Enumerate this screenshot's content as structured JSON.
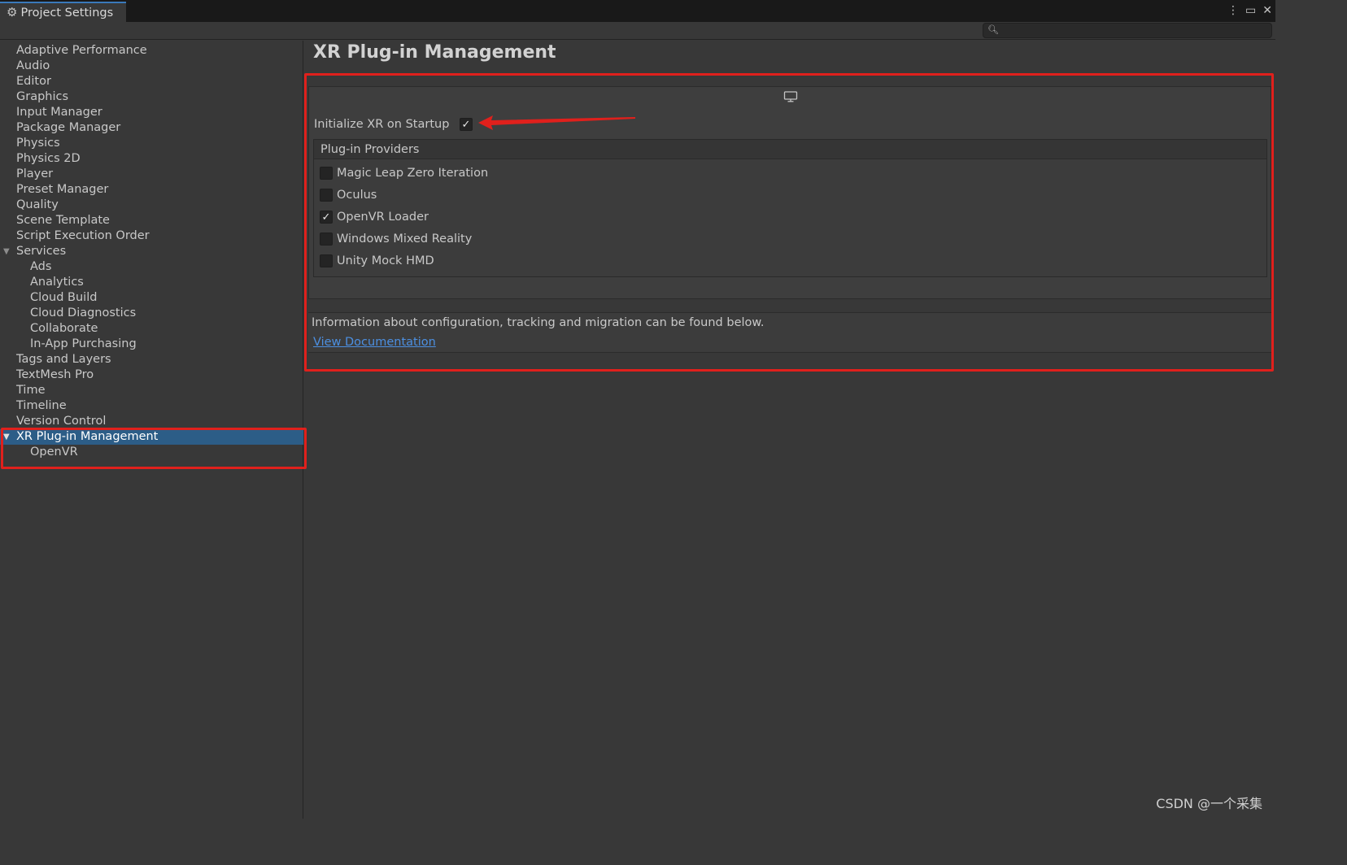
{
  "window": {
    "tab_title": "Project Settings",
    "tab_icon": "gear-icon",
    "controls": {
      "menu": "⋮",
      "maximize": "▭",
      "close": "✕"
    }
  },
  "search": {
    "value": "",
    "placeholder": ""
  },
  "sidebar": {
    "items": [
      {
        "label": "Adaptive Performance",
        "level": 0
      },
      {
        "label": "Audio",
        "level": 0
      },
      {
        "label": "Editor",
        "level": 0
      },
      {
        "label": "Graphics",
        "level": 0
      },
      {
        "label": "Input Manager",
        "level": 0
      },
      {
        "label": "Package Manager",
        "level": 0
      },
      {
        "label": "Physics",
        "level": 0
      },
      {
        "label": "Physics 2D",
        "level": 0
      },
      {
        "label": "Player",
        "level": 0
      },
      {
        "label": "Preset Manager",
        "level": 0
      },
      {
        "label": "Quality",
        "level": 0
      },
      {
        "label": "Scene Template",
        "level": 0
      },
      {
        "label": "Script Execution Order",
        "level": 0
      },
      {
        "label": "Services",
        "level": 0,
        "expanded": true
      },
      {
        "label": "Ads",
        "level": 1
      },
      {
        "label": "Analytics",
        "level": 1
      },
      {
        "label": "Cloud Build",
        "level": 1
      },
      {
        "label": "Cloud Diagnostics",
        "level": 1
      },
      {
        "label": "Collaborate",
        "level": 1
      },
      {
        "label": "In-App Purchasing",
        "level": 1
      },
      {
        "label": "Tags and Layers",
        "level": 0
      },
      {
        "label": "TextMesh Pro",
        "level": 0
      },
      {
        "label": "Time",
        "level": 0
      },
      {
        "label": "Timeline",
        "level": 0
      },
      {
        "label": "Version Control",
        "level": 0
      },
      {
        "label": "XR Plug-in Management",
        "level": 0,
        "expanded": true,
        "selected": true
      },
      {
        "label": "OpenVR",
        "level": 1
      }
    ]
  },
  "main": {
    "title": "XR Plug-in Management",
    "platform_icon": "monitor-icon",
    "init_label": "Initialize XR on Startup",
    "init_checked": true,
    "providers_header": "Plug-in Providers",
    "providers": [
      {
        "label": "Magic Leap Zero Iteration",
        "checked": false
      },
      {
        "label": "Oculus",
        "checked": false
      },
      {
        "label": "OpenVR Loader",
        "checked": true
      },
      {
        "label": "Windows Mixed Reality",
        "checked": false
      },
      {
        "label": "Unity Mock HMD",
        "checked": false
      }
    ],
    "info_text": "Information about configuration, tracking and migration can be found below.",
    "doc_link": "View Documentation"
  },
  "annotations": {
    "color": "#e0201c"
  },
  "colors": {
    "selection": "#2c5d87",
    "link": "#4c8fe0",
    "background": "#383838"
  },
  "watermark": "CSDN @一个采集"
}
